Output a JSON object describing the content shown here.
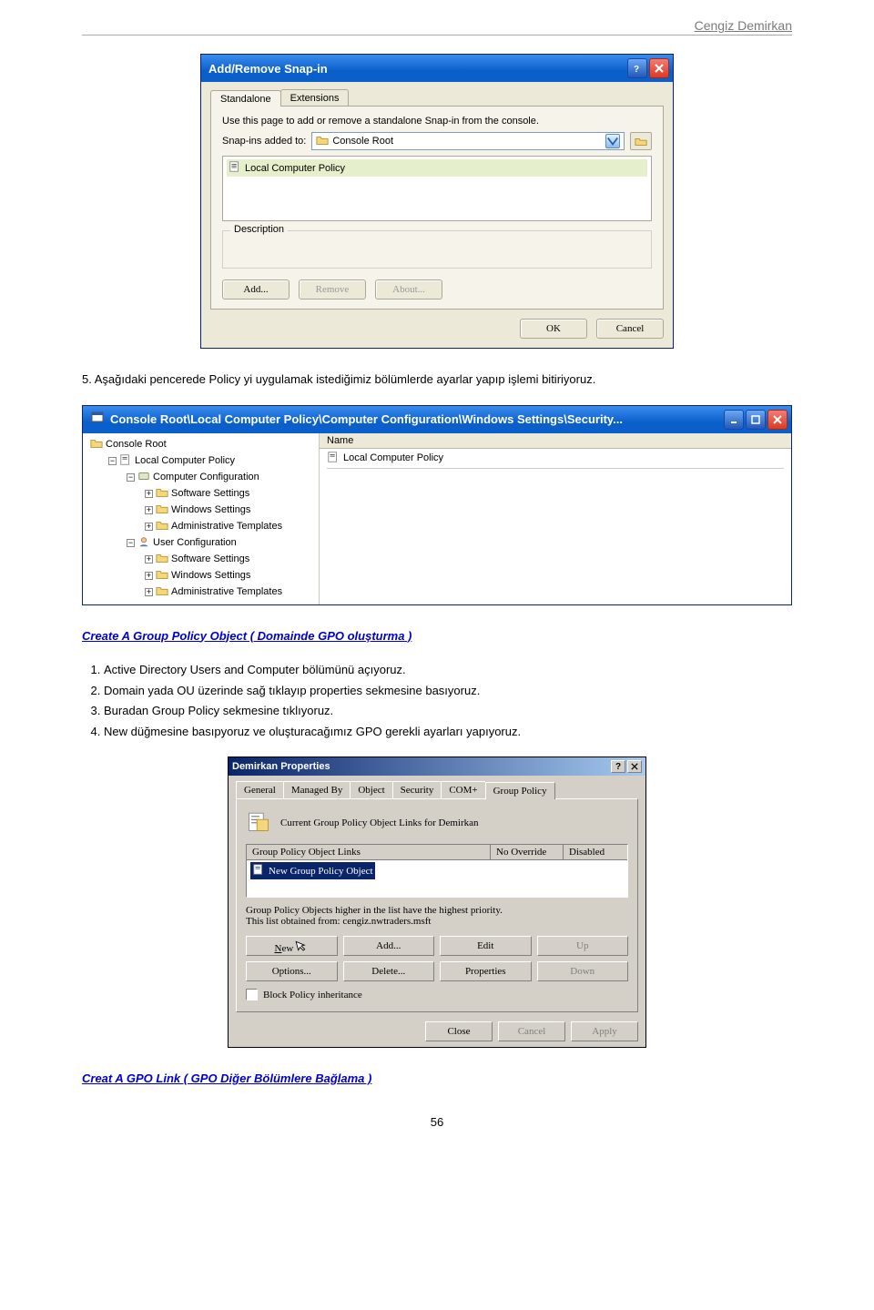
{
  "header_name": "Cengiz Demirkan",
  "page_number": "56",
  "dialog1": {
    "title": "Add/Remove Snap-in",
    "tab_standalone": "Standalone",
    "tab_extensions": "Extensions",
    "desc_line": "Use this page to add or remove a standalone Snap-in from the console.",
    "snapins_label": "Snap-ins added to:",
    "combo_value": "Console Root",
    "list_item": "Local Computer Policy",
    "description_label": "Description",
    "btn_add": "Add...",
    "btn_remove": "Remove",
    "btn_about": "About...",
    "btn_ok": "OK",
    "btn_cancel": "Cancel"
  },
  "para5": "5. Aşağıdaki pencerede Policy yi uygulamak istediğimiz bölümlerde ayarlar yapıp işlemi bitiriyoruz.",
  "mmc": {
    "title": "Console Root\\Local Computer Policy\\Computer Configuration\\Windows Settings\\Security...",
    "col_name": "Name",
    "row_item": "Local Computer Policy",
    "tree": {
      "root": "Console Root",
      "lcp": "Local Computer Policy",
      "comp": "Computer Configuration",
      "ss": "Software Settings",
      "ws": "Windows Settings",
      "at": "Administrative Templates",
      "user": "User Configuration"
    }
  },
  "heading_create": "Create A Group Policy Object ( Domainde GPO oluşturma )",
  "steps_create": [
    "Active Directory Users and Computer bölümünü açıyoruz.",
    "Domain yada OU üzerinde sağ tıklayıp properties sekmesine basıyoruz.",
    "Buradan Group Policy sekmesine tıklıyoruz.",
    "New düğmesine basıpyoruz ve oluşturacağımız GPO gerekli ayarları yapıyoruz."
  ],
  "props": {
    "title": "Demirkan Properties",
    "tabs": [
      "General",
      "Managed By",
      "Object",
      "Security",
      "COM+",
      "Group Policy"
    ],
    "line1": "Current Group Policy Object Links for Demirkan",
    "col1": "Group Policy Object Links",
    "col2": "No Override",
    "col3": "Disabled",
    "row_item": "New Group Policy Object",
    "line2a": "Group Policy Objects higher in the list have the highest priority.",
    "line2b": "This list obtained from: cengiz.nwtraders.msft",
    "btn_new": "New",
    "btn_add": "Add...",
    "btn_edit": "Edit",
    "btn_up": "Up",
    "btn_options": "Options...",
    "btn_delete": "Delete...",
    "btn_properties": "Properties",
    "btn_down": "Down",
    "chk_label": "Block Policy inheritance",
    "btn_close": "Close",
    "btn_cancel": "Cancel",
    "btn_apply": "Apply"
  },
  "heading_link": "Creat A GPO Link ( GPO Diğer Bölümlere Bağlama )"
}
